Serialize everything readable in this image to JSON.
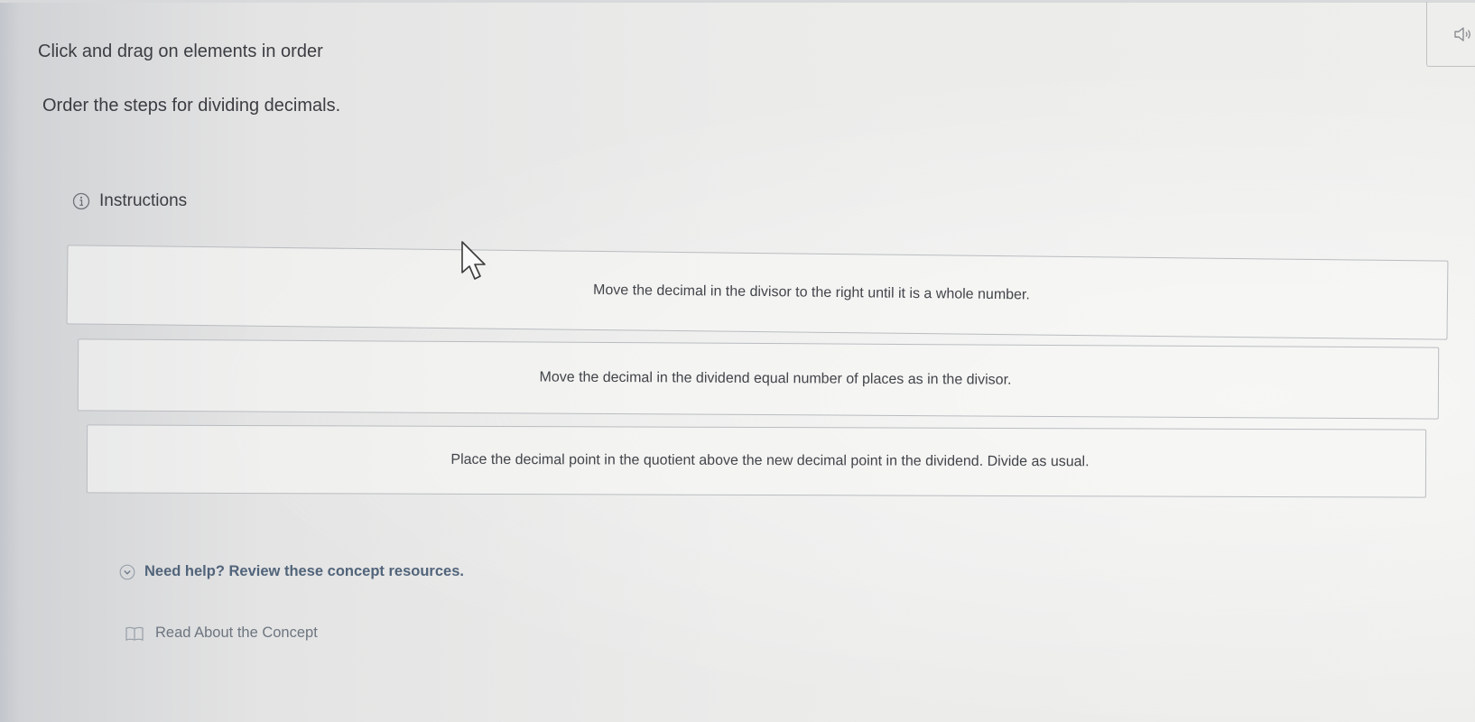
{
  "header": {
    "prompt": "Click and drag on elements in order",
    "question": "Order the steps for dividing decimals.",
    "audio_icon": "speaker-icon"
  },
  "instructions": {
    "icon": "info-icon",
    "label": "Instructions"
  },
  "steps": [
    "Move the decimal in the divisor to the right until it is a whole number.",
    "Move the decimal in the dividend equal number of places as in the divisor.",
    "Place the decimal point in the quotient above the new decimal point in the dividend. Divide as usual."
  ],
  "help": {
    "icon": "chevron-down-icon",
    "label": "Need help? Review these concept resources.",
    "resource_icon": "book-icon",
    "resource_label": "Read About the Concept"
  },
  "colors": {
    "text": "#3b3d42",
    "help_link": "#51647a",
    "border": "#b9bcc0"
  }
}
